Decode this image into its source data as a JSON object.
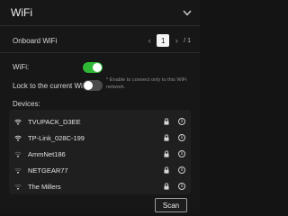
{
  "header": {
    "title": "WiFi",
    "chevron_icon": "chevron-down-icon"
  },
  "onboard": {
    "label": "Onboard WiFi",
    "current_page": "1",
    "total_pages": "/ 1",
    "prev_icon": "chevron-left-icon",
    "next_icon": "chevron-right-icon"
  },
  "wifi_toggle": {
    "label": "WiFi:",
    "state": "on",
    "color": "#2eb836"
  },
  "lock_toggle": {
    "label": "Lock to the current WiFi:",
    "state": "off",
    "note": "* Enable to connect only to this WiFi network."
  },
  "devices": {
    "label": "Devices:",
    "items": [
      {
        "name": "TVUPACK_D3EE",
        "signal": "full"
      },
      {
        "name": "TP-Link_028C-199",
        "signal": "full"
      },
      {
        "name": "AmmNet186",
        "signal": "low"
      },
      {
        "name": "NETGEAR77",
        "signal": "low"
      },
      {
        "name": "The Millers",
        "signal": "low"
      }
    ]
  },
  "actions": {
    "scan_label": "Scan"
  }
}
